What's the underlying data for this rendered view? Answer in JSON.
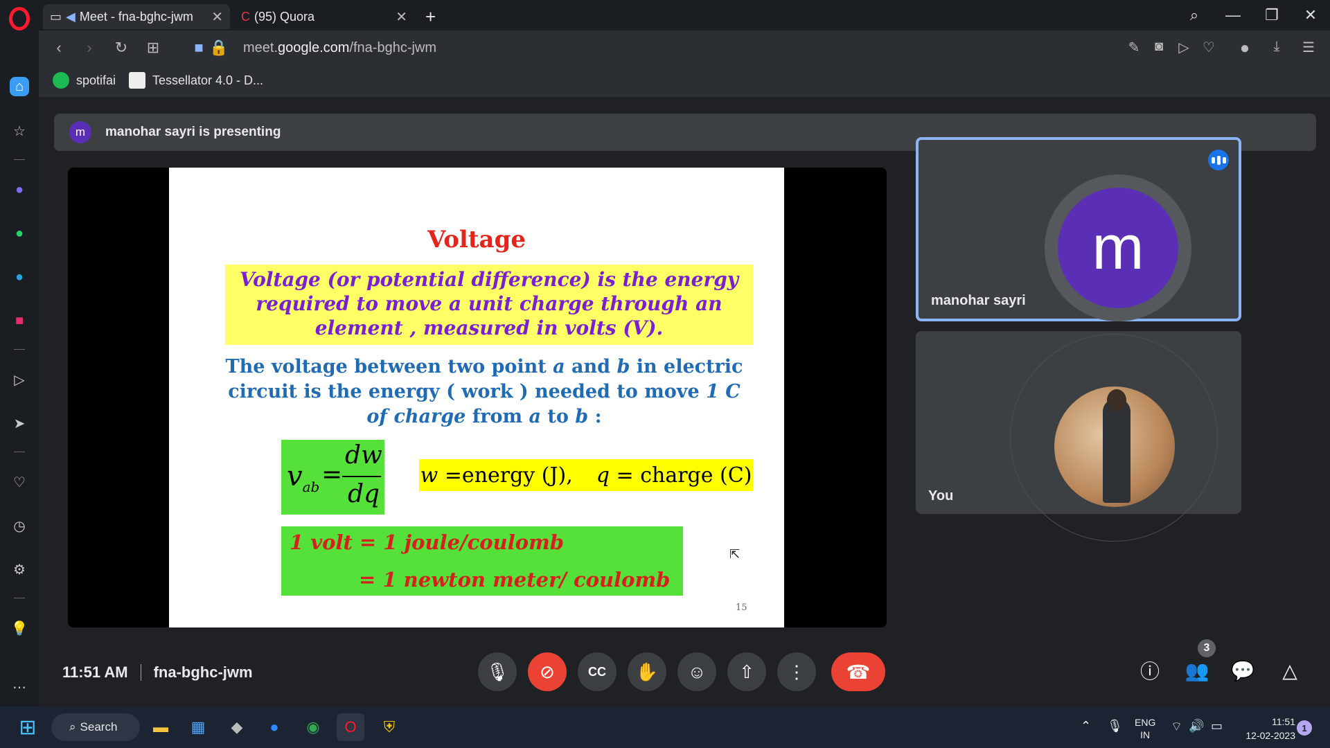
{
  "browser": {
    "tabs": [
      {
        "label": "Meet - fna-bghc-jwm",
        "active": true
      },
      {
        "label": "(95) Quora",
        "active": false
      }
    ],
    "url_prefix": "meet.",
    "url_domain": "google.com",
    "url_path": "/fna-bghc-jwm",
    "bookmarks": [
      {
        "label": "spotifai",
        "icon": "spotify-icon"
      },
      {
        "label": "Tessellator 4.0 - D...",
        "icon": "tu-icon"
      }
    ],
    "sidebar_icons": [
      "home-icon",
      "star-icon",
      "messenger-icon",
      "whatsapp-icon",
      "telegram-icon",
      "instagram-icon",
      "player-icon",
      "send-icon",
      "heart-icon",
      "history-icon",
      "settings-icon",
      "lightbulb-icon",
      "more-icon"
    ]
  },
  "meet": {
    "presenting_avatar_letter": "m",
    "presenting_text": "manohar sayri is presenting",
    "slide": {
      "title": "Voltage",
      "definition_line1": "Voltage (or potential difference) is the energy",
      "definition_line2": "required to move a unit charge through an",
      "definition_line3": "element , measured in volts (V).",
      "desc_line1_a": "The voltage between two point ",
      "desc_line1_var_a": "a",
      "desc_line1_b": " and ",
      "desc_line1_var_b": "b",
      "desc_line1_c": " in electric",
      "desc_line2_a": "circuit is the energy ( work ) needed to move ",
      "desc_line2_em": "1 C",
      "desc_line3_em": "of charge",
      "desc_line3_b": " from ",
      "desc_line3_var_a": "a",
      "desc_line3_c": " to ",
      "desc_line3_var_b": "b",
      "desc_line3_d": " :",
      "formula_lhs": "v",
      "formula_sub": "ab",
      "formula_eq": "=",
      "formula_num": "dw",
      "formula_den": "dq",
      "var_w": "w",
      "var_w_def": "=energy (J),",
      "var_q": "q",
      "var_q_def": "= charge (C)",
      "unit_line1": "1 volt = 1 joule/coulomb",
      "unit_line2": "= 1 newton meter/ coulomb",
      "page_number": "15"
    },
    "participants": [
      {
        "name": "manohar sayri",
        "avatar_letter": "m",
        "avatar_color": "#5b2fb5",
        "speaking": true
      },
      {
        "name": "You"
      }
    ],
    "time": "11:51 AM",
    "meeting_code": "fna-bghc-jwm",
    "people_count": "3",
    "accent": "#8ab4f8",
    "end_call_color": "#ea4335"
  },
  "taskbar": {
    "search_label": "Search",
    "lang_line1": "ENG",
    "lang_line2": "IN",
    "clock_time": "11:51",
    "clock_date": "12-02-2023",
    "notification_count": "1"
  }
}
